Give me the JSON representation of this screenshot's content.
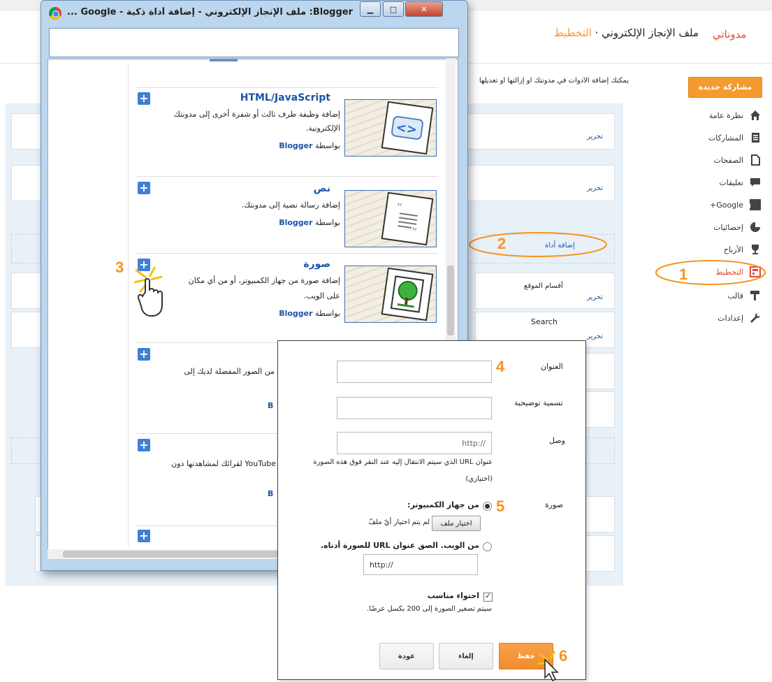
{
  "header": {
    "brand": "مدوناتي",
    "blog_name": "ملف الإنجاز الإلكتروني",
    "separator": "·",
    "current_section": "التخطيط"
  },
  "intro_text": "يمكنك إضافة الأدوات في مدونتك أو إزالتها أو تعديلها",
  "sidebar": {
    "new_post": "مشاركة جديدة",
    "items": [
      {
        "label": "نظرة عامة",
        "icon": "home-icon"
      },
      {
        "label": "المشاركات",
        "icon": "posts-icon"
      },
      {
        "label": "الصفحات",
        "icon": "pages-icon"
      },
      {
        "label": "تعليقات",
        "icon": "comments-icon"
      },
      {
        "label": "Google+",
        "icon": "google-plus-icon"
      },
      {
        "label": "إحصائيات",
        "icon": "stats-icon"
      },
      {
        "label": "الأرباح",
        "icon": "trophy-icon"
      },
      {
        "label": "التخطيط",
        "icon": "layout-icon"
      },
      {
        "label": "قالب",
        "icon": "template-icon"
      },
      {
        "label": "إعدادات",
        "icon": "wrench-icon"
      }
    ]
  },
  "layout": {
    "edit": "تحرير",
    "add_gadget": "إضافة أداة",
    "site_sections": "أقسام الموقع",
    "search": "Search"
  },
  "callouts": [
    "1",
    "2",
    "3",
    "4",
    "5",
    "6"
  ],
  "popup": {
    "title": "Blogger: ملف الإنجاز الإلكتروني - إضافة أداة ذكية - Google ...",
    "gadgets": [
      {
        "title": "HTML/JavaScript",
        "desc1": "إضافة وظيفة طرف ثالث أو شفرة أخرى إلى مدونتك",
        "desc2": "الإلكترونية.",
        "by": "بواسطة",
        "author": "Blogger"
      },
      {
        "title": "نص",
        "desc1": "إضافة رسالة نصية إلى مدونتك.",
        "by": "بواسطة",
        "author": "Blogger"
      },
      {
        "title": "صورة",
        "desc1": "إضافة صورة من جهاز الكمبيوتر، أو من أي مكان",
        "desc2": "على الويب.",
        "by": "بواسطة",
        "author": "Blogger"
      },
      {
        "desc1": "رائح من الصور المفضلة لديك إلى",
        "author": "B"
      },
      {
        "desc1": "YouTube لقرائك لمشاهدتها دون",
        "author": "B"
      }
    ]
  },
  "dialog": {
    "title_label": "العنوان",
    "caption_label": "تسمية توضيحية",
    "link_label": "وصل",
    "link_value": "http://",
    "link_help": "عنوان URL الذي سيتم الانتقال إليه عند النقر فوق هذه الصورة",
    "link_help2": "(اختياري)",
    "image_label": "صورة",
    "from_computer": "من جهاز الكمبيوتر:",
    "choose_file": "اختيار ملف",
    "no_file": "لم يتم اختيار أيّ ملفّ",
    "from_web": "من الويب. الصق عنوان URL للصورة أدناه.",
    "web_value": "http://",
    "fit_label": "احتواء مناسب",
    "fit_help": "سيتم تصغير الصورة إلى 200 بكسل عرضًا.",
    "save": "حفظ",
    "cancel": "إلغاء",
    "back": "عودة"
  }
}
